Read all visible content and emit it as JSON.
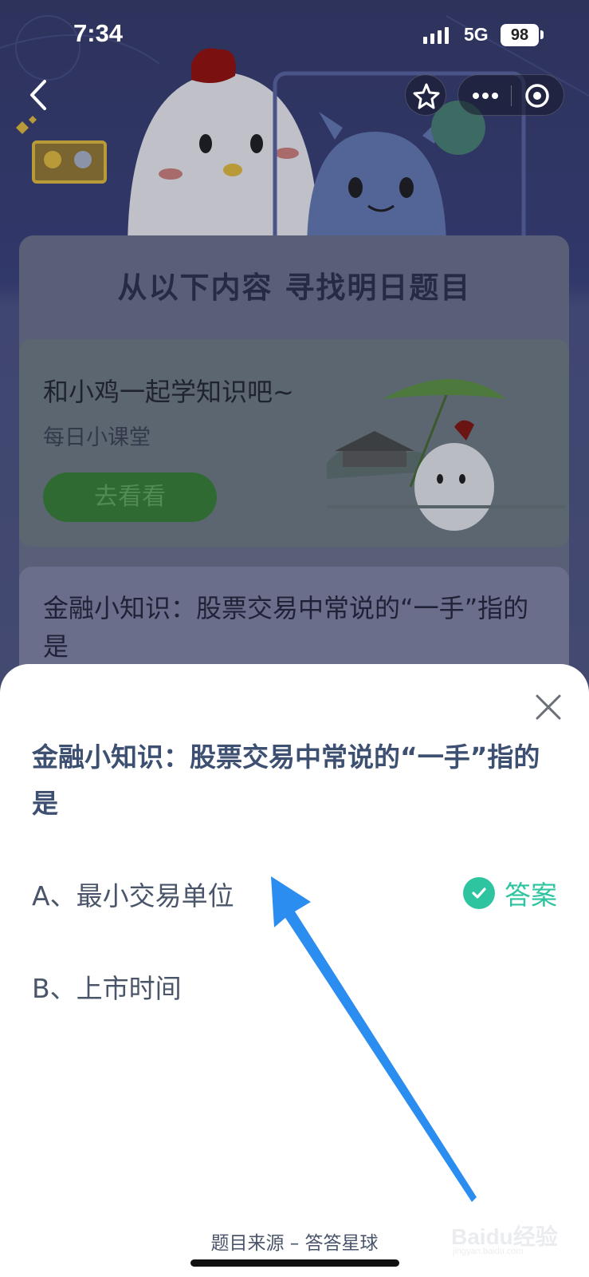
{
  "status_bar": {
    "time": "7:34",
    "network": "5G",
    "battery": "98"
  },
  "background": {
    "panel_title": "从以下内容 寻找明日题目",
    "card1": {
      "title": "和小鸡一起学知识吧~",
      "subtitle": "每日小课堂",
      "button": "去看看"
    },
    "card2": {
      "title": "金融小知识：股票交易中常说的“一手”指的是"
    }
  },
  "sheet": {
    "question": "金融小知识：股票交易中常说的“一手”指的是",
    "options": [
      {
        "label": "A、最小交易单位",
        "is_answer": true
      },
      {
        "label": "B、上市时间",
        "is_answer": false
      }
    ],
    "answer_label": "答案",
    "source": "题目来源 – 答答星球"
  },
  "watermark": {
    "brand": "Baidu经验",
    "url": "jingyan.baidu.com"
  },
  "colors": {
    "accent": "#2ec4a0",
    "arrow": "#2b8df0",
    "question_text": "#3d5072"
  },
  "icons": [
    "back-chevron-icon",
    "star-icon",
    "more-dots-icon",
    "target-icon",
    "close-icon",
    "check-icon"
  ]
}
